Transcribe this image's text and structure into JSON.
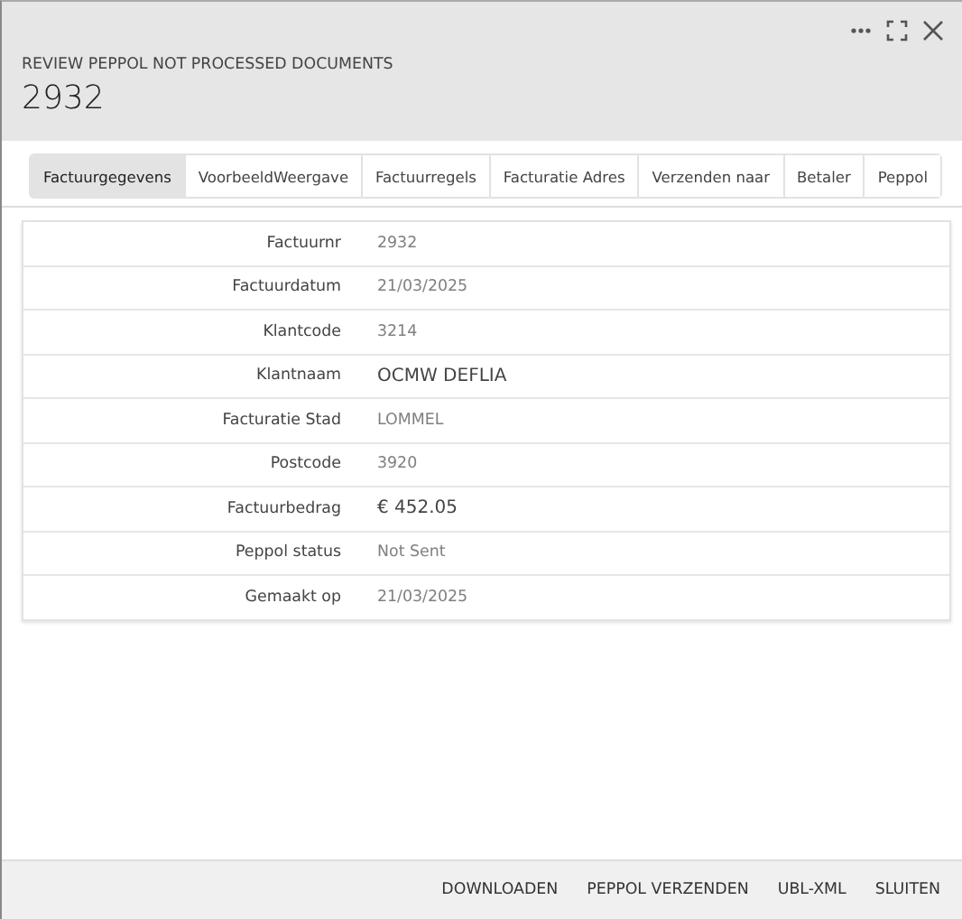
{
  "header": {
    "subtitle": "REVIEW PEPPOL NOT PROCESSED DOCUMENTS",
    "title": "2932"
  },
  "tabs": [
    {
      "label": "Factuurgegevens",
      "selected": true
    },
    {
      "label": "VoorbeeldWeergave",
      "selected": false
    },
    {
      "label": "Factuurregels",
      "selected": false
    },
    {
      "label": "Facturatie Adres",
      "selected": false
    },
    {
      "label": "Verzenden naar",
      "selected": false
    },
    {
      "label": "Betaler",
      "selected": false
    },
    {
      "label": "Peppol",
      "selected": false
    }
  ],
  "fields": [
    {
      "label": "Factuurnr",
      "value": "2932",
      "emphasized": false
    },
    {
      "label": "Factuurdatum",
      "value": "21/03/2025",
      "emphasized": false
    },
    {
      "label": "Klantcode",
      "value": "3214",
      "emphasized": false
    },
    {
      "label": "Klantnaam",
      "value": "OCMW DEFLIA",
      "emphasized": true
    },
    {
      "label": "Facturatie Stad",
      "value": "LOMMEL",
      "emphasized": false
    },
    {
      "label": "Postcode",
      "value": "3920",
      "emphasized": false
    },
    {
      "label": "Factuurbedrag",
      "value": "€ 452.05",
      "emphasized": true
    },
    {
      "label": "Peppol status",
      "value": "Not Sent",
      "emphasized": false
    },
    {
      "label": "Gemaakt op",
      "value": "21/03/2025",
      "emphasized": false
    }
  ],
  "buttons": [
    "DOWNLOADEN",
    "PEPPOL VERZENDEN",
    "UBL-XML",
    "SLUITEN"
  ]
}
